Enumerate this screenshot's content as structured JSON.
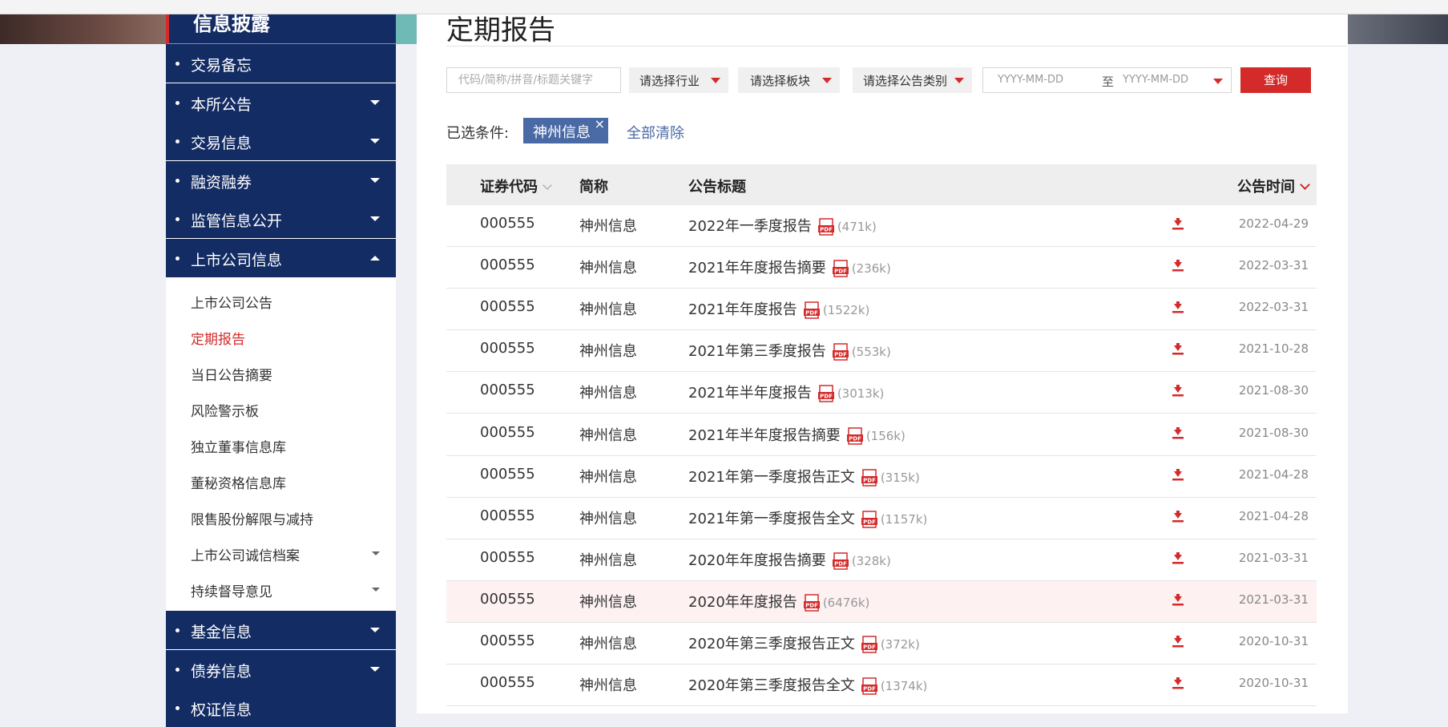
{
  "sidebar": {
    "header": "信息披露",
    "items": [
      {
        "label": "交易备忘",
        "arrow": ""
      },
      {
        "label": "本所公告",
        "arrow": "down"
      },
      {
        "label": "交易信息",
        "arrow": "down"
      },
      {
        "label": "融资融券",
        "arrow": "down"
      },
      {
        "label": "监管信息公开",
        "arrow": "down"
      },
      {
        "label": "上市公司信息",
        "arrow": "up"
      }
    ],
    "sub_items": [
      {
        "label": "上市公司公告",
        "active": false,
        "arrow": false
      },
      {
        "label": "定期报告",
        "active": true,
        "arrow": false
      },
      {
        "label": "当日公告摘要",
        "active": false,
        "arrow": false
      },
      {
        "label": "风险警示板",
        "active": false,
        "arrow": false
      },
      {
        "label": "独立董事信息库",
        "active": false,
        "arrow": false
      },
      {
        "label": "董秘资格信息库",
        "active": false,
        "arrow": false
      },
      {
        "label": "限售股份解限与减持",
        "active": false,
        "arrow": false
      },
      {
        "label": "上市公司诚信档案",
        "active": false,
        "arrow": true
      },
      {
        "label": "持续督导意见",
        "active": false,
        "arrow": true
      }
    ],
    "bottom_items": [
      {
        "label": "基金信息",
        "arrow": "down"
      },
      {
        "label": "债券信息",
        "arrow": "down"
      },
      {
        "label": "权证信息",
        "arrow": ""
      }
    ]
  },
  "main": {
    "title": "定期报告",
    "filters": {
      "search_placeholder": "代码/简称/拼音/标题关键字",
      "industry": "请选择行业",
      "board": "请选择板块",
      "category": "请选择公告类别",
      "date_from": "YYYY-MM-DD",
      "date_to_label": "至",
      "date_to": "YYYY-MM-DD",
      "query_button": "查询"
    },
    "selected": {
      "label": "已选条件:",
      "tag": "神州信息",
      "tag_close": "×",
      "clear_all": "全部清除"
    },
    "table": {
      "headers": {
        "code": "证券代码",
        "name": "简称",
        "title": "公告标题",
        "date": "公告时间"
      },
      "rows": [
        {
          "code": "000555",
          "name": "神州信息",
          "title": "2022年一季度报告",
          "size": "(471k)",
          "date": "2022-04-29"
        },
        {
          "code": "000555",
          "name": "神州信息",
          "title": "2021年年度报告摘要",
          "size": "(236k)",
          "date": "2022-03-31"
        },
        {
          "code": "000555",
          "name": "神州信息",
          "title": "2021年年度报告",
          "size": "(1522k)",
          "date": "2022-03-31"
        },
        {
          "code": "000555",
          "name": "神州信息",
          "title": "2021年第三季度报告",
          "size": "(553k)",
          "date": "2021-10-28"
        },
        {
          "code": "000555",
          "name": "神州信息",
          "title": "2021年半年度报告",
          "size": "(3013k)",
          "date": "2021-08-30"
        },
        {
          "code": "000555",
          "name": "神州信息",
          "title": "2021年半年度报告摘要",
          "size": "(156k)",
          "date": "2021-08-30"
        },
        {
          "code": "000555",
          "name": "神州信息",
          "title": "2021年第一季度报告正文",
          "size": "(315k)",
          "date": "2021-04-28"
        },
        {
          "code": "000555",
          "name": "神州信息",
          "title": "2021年第一季度报告全文",
          "size": "(1157k)",
          "date": "2021-04-28"
        },
        {
          "code": "000555",
          "name": "神州信息",
          "title": "2020年年度报告摘要",
          "size": "(328k)",
          "date": "2021-03-31"
        },
        {
          "code": "000555",
          "name": "神州信息",
          "title": "2020年年度报告",
          "size": "(6476k)",
          "date": "2021-03-31",
          "highlight": true
        },
        {
          "code": "000555",
          "name": "神州信息",
          "title": "2020年第三季度报告正文",
          "size": "(372k)",
          "date": "2020-10-31"
        },
        {
          "code": "000555",
          "name": "神州信息",
          "title": "2020年第三季度报告全文",
          "size": "(1374k)",
          "date": "2020-10-31"
        }
      ]
    }
  },
  "icons": {
    "pdf": "pdf-file-icon",
    "download": "download-icon"
  },
  "colors": {
    "sidebar_bg": "#132c64",
    "accent_red": "#d42a2a",
    "tag_blue": "#4a6aa5",
    "highlight_row": "#fdf1f2"
  }
}
